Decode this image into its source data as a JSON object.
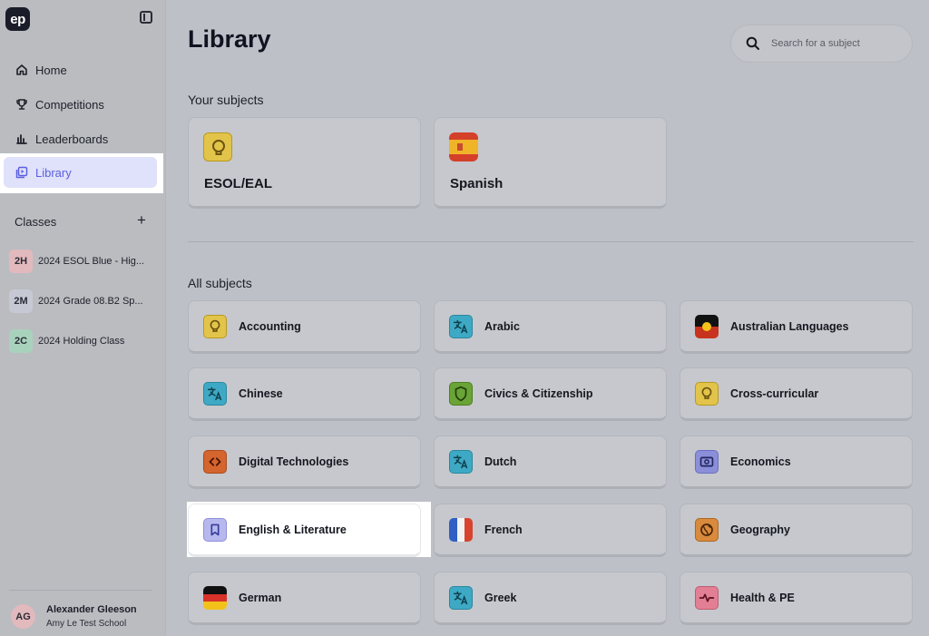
{
  "app": {
    "logo_text": "ep"
  },
  "sidebar": {
    "nav": [
      {
        "label": "Home",
        "icon": "home-icon"
      },
      {
        "label": "Competitions",
        "icon": "trophy-icon"
      },
      {
        "label": "Leaderboards",
        "icon": "bar-chart-icon"
      },
      {
        "label": "Library",
        "icon": "library-icon",
        "active": true
      }
    ],
    "classes_label": "Classes",
    "add_label": "+",
    "classes": [
      {
        "badge": "2H",
        "name": "2024 ESOL Blue - Hig...",
        "color": "#e2b9bd"
      },
      {
        "badge": "2M",
        "name": "2024 Grade 08.B2 Sp...",
        "color": "#c6c9d3"
      },
      {
        "badge": "2C",
        "name": "2024 Holding Class",
        "color": "#a9d2bd"
      }
    ],
    "user": {
      "initials": "AG",
      "name": "Alexander Gleeson",
      "school": "Amy Le Test School"
    }
  },
  "main": {
    "title": "Library",
    "search": {
      "placeholder": "Search for a subject"
    },
    "your_subjects_label": "Your subjects",
    "your_subjects": [
      {
        "label": "ESOL/EAL",
        "icon": "lightbulb-icon"
      },
      {
        "label": "Spanish",
        "icon": "spain-flag-icon"
      }
    ],
    "all_subjects_label": "All subjects",
    "all_subjects": [
      {
        "label": "Accounting",
        "icon": "lightbulb-icon"
      },
      {
        "label": "Arabic",
        "icon": "translate-icon"
      },
      {
        "label": "Australian Languages",
        "icon": "aboriginal-flag-icon"
      },
      {
        "label": "Chinese",
        "icon": "translate-icon"
      },
      {
        "label": "Civics & Citizenship",
        "icon": "shield-icon"
      },
      {
        "label": "Cross-curricular",
        "icon": "lightbulb-icon"
      },
      {
        "label": "Digital Technologies",
        "icon": "code-icon"
      },
      {
        "label": "Dutch",
        "icon": "translate-icon"
      },
      {
        "label": "Economics",
        "icon": "money-icon"
      },
      {
        "label": "English & Literature",
        "icon": "bookmark-icon"
      },
      {
        "label": "French",
        "icon": "france-flag-icon"
      },
      {
        "label": "Geography",
        "icon": "globe-icon"
      },
      {
        "label": "German",
        "icon": "germany-flag-icon"
      },
      {
        "label": "Greek",
        "icon": "translate-icon"
      },
      {
        "label": "Health & PE",
        "icon": "heartbeat-icon"
      }
    ]
  }
}
